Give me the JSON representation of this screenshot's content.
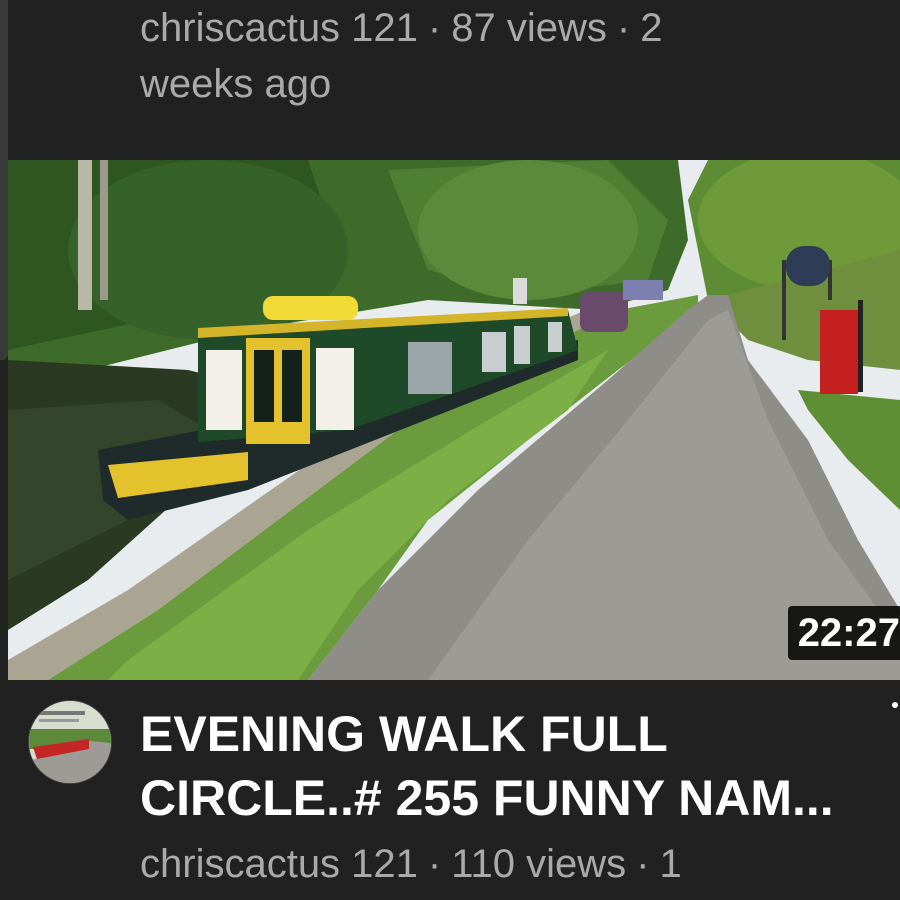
{
  "previous_video": {
    "channel": "chriscactus 121",
    "views": "87 views",
    "age_line1": "2",
    "age_line2": "weeks ago",
    "separator": "·"
  },
  "video": {
    "title_line1": "EVENING WALK FULL",
    "title_line2": "CIRCLE..# 255 FUNNY NAM...",
    "duration": "22:27",
    "channel": "chriscactus 121",
    "views": "110 views",
    "age": "1",
    "separator": "·",
    "thumbnail_icon": "canal-boat-thumbnail",
    "avatar_icon": "channel-avatar"
  },
  "colors": {
    "background": "#212121",
    "meta_text": "#aaaaaa",
    "title_text": "#ffffff"
  }
}
